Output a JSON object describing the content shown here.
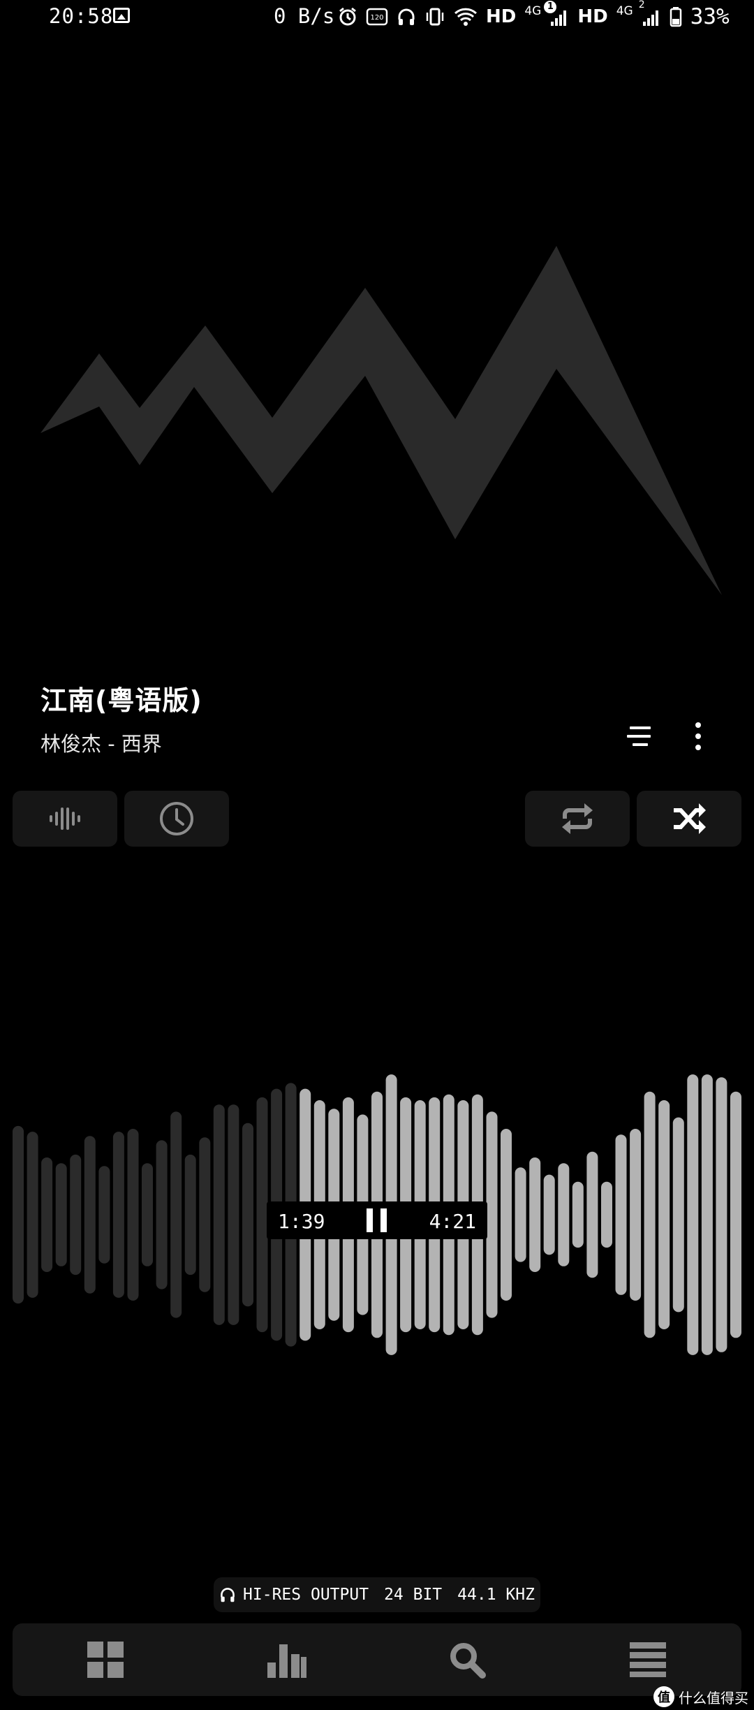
{
  "status_bar": {
    "time": "20:58",
    "net_speed": "0 B/s",
    "hd1": "HD",
    "net1": "4G",
    "sim1_badge": "1",
    "hd2": "HD",
    "net2": "4G",
    "sim2_badge": "2",
    "battery": "33%"
  },
  "song": {
    "title": "江南(粤语版)",
    "artist_album": "林俊杰 - 西界"
  },
  "playback": {
    "current_time": "1:39",
    "total_time": "4:21",
    "progress": 0.38
  },
  "output": {
    "label": "HI-RES OUTPUT",
    "bit_depth": "24 BIT",
    "sample_rate": "44.1 KHZ"
  },
  "waveform_levels": [
    0.62,
    0.58,
    0.4,
    0.36,
    0.42,
    0.55,
    0.34,
    0.58,
    0.6,
    0.36,
    0.52,
    0.72,
    0.42,
    0.54,
    0.77,
    0.77,
    0.64,
    0.82,
    0.88,
    0.92,
    0.88,
    0.8,
    0.74,
    0.82,
    0.7,
    0.86,
    0.98,
    0.82,
    0.8,
    0.82,
    0.84,
    0.8,
    0.84,
    0.72,
    0.6,
    0.33,
    0.4,
    0.28,
    0.36,
    0.23,
    0.44,
    0.23,
    0.56,
    0.6,
    0.86,
    0.8,
    0.68,
    0.98,
    0.98,
    0.96,
    0.86
  ],
  "watermark": "什么值得买",
  "colors": {
    "background": "#000000",
    "tile": "#161616",
    "played_bar": "#b3b3b3",
    "unplayed_bar": "#2b2b2b",
    "artwork": "#2a2a2a",
    "icon_dim": "#8c8c8c"
  },
  "icons": {
    "waveform_tile": "waveform-icon",
    "timer_tile": "clock-icon",
    "repeat_tile": "repeat-icon",
    "shuffle_tile": "shuffle-icon",
    "nav": [
      "grid-icon",
      "chart-icon",
      "search-icon",
      "menu-icon"
    ]
  }
}
